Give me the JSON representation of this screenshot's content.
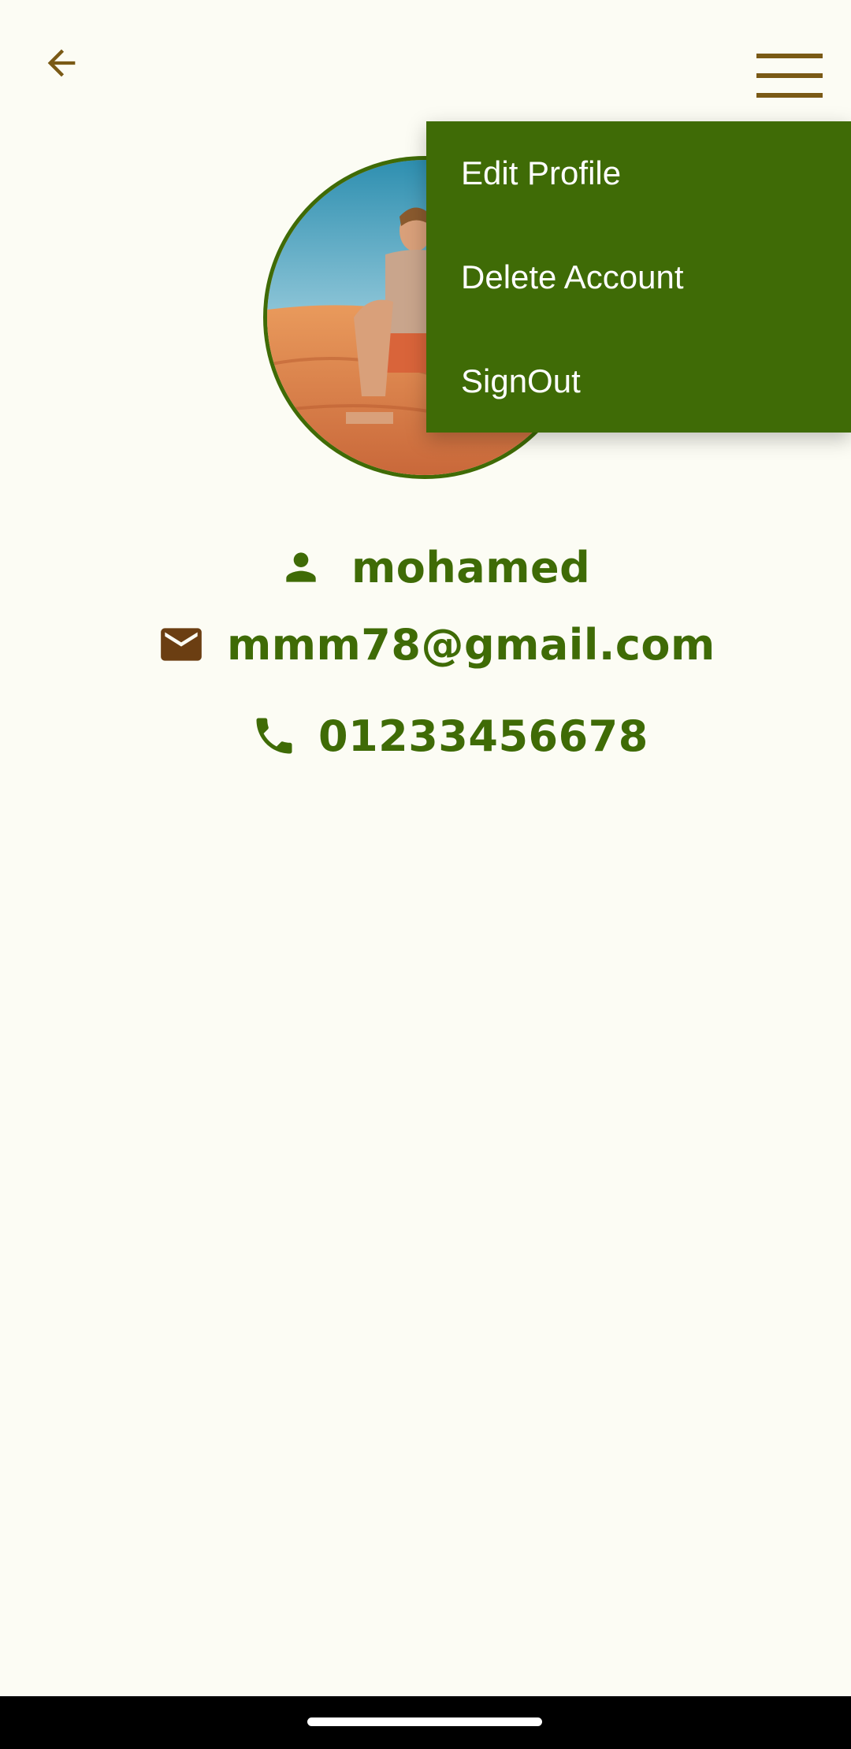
{
  "colors": {
    "background": "#FCFCF4",
    "accent_green": "#3F6B06",
    "icon_brown": "#7A5A16",
    "menu_bg": "#3F6B06",
    "menu_text": "#FFFFFF"
  },
  "top_bar": {
    "back_icon": "arrow-back-icon",
    "menu_icon": "hamburger-menu-icon"
  },
  "profile": {
    "avatar_icon": "profile-photo",
    "name": "mohamed",
    "email": "mmm78@gmail.com",
    "phone": "01233456678",
    "name_icon": "person-icon",
    "email_icon": "mail-icon",
    "phone_icon": "phone-icon"
  },
  "menu": {
    "items": [
      {
        "label": "Edit Profile"
      },
      {
        "label": "Delete Account"
      },
      {
        "label": "SignOut"
      }
    ]
  }
}
